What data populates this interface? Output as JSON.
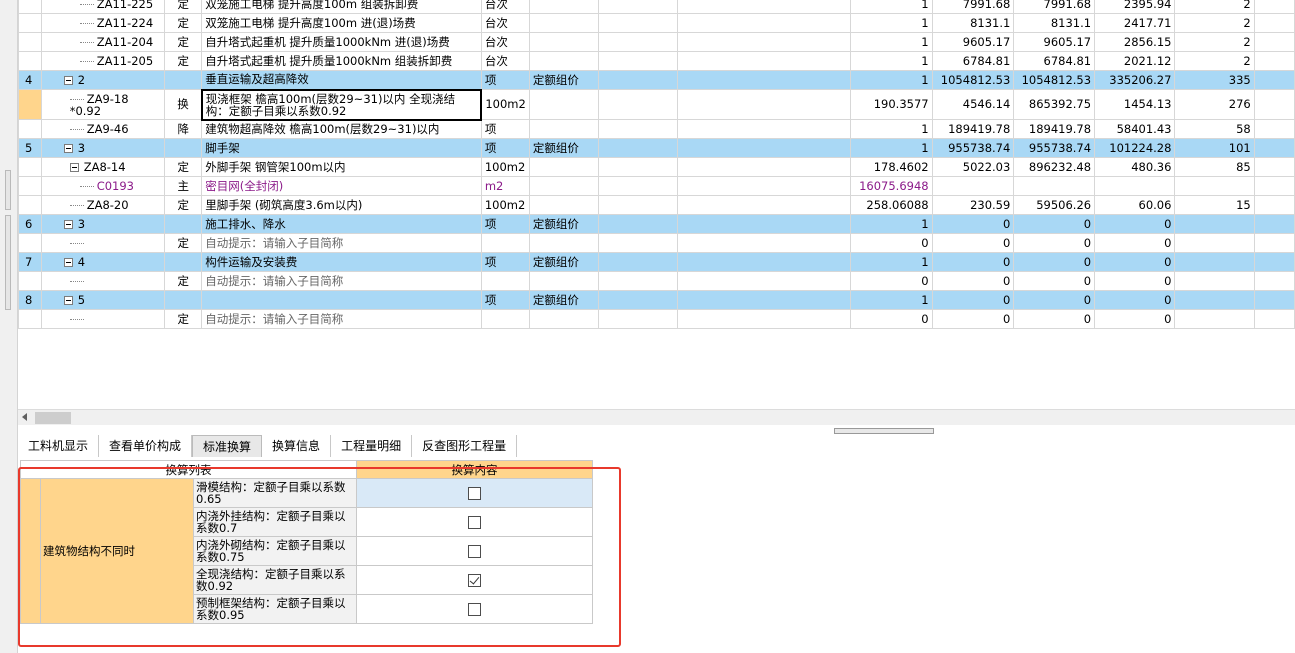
{
  "rows": [
    {
      "no": "",
      "code": "ZA11-225",
      "type": "定",
      "name": "双笼施工电梯 提升高度100m 组装拆卸费",
      "unit": "台次",
      "fee": "",
      "qty": "1",
      "price": "7991.68",
      "total": "7991.68",
      "labor": "2395.94",
      "extra": "2",
      "level": 2,
      "style": "normal"
    },
    {
      "no": "",
      "code": "ZA11-224",
      "type": "定",
      "name": "双笼施工电梯 提升高度100m 进(退)场费",
      "unit": "台次",
      "fee": "",
      "qty": "1",
      "price": "8131.1",
      "total": "8131.1",
      "labor": "2417.71",
      "extra": "2",
      "level": 2,
      "style": "normal"
    },
    {
      "no": "",
      "code": "ZA11-204",
      "type": "定",
      "name": "自升塔式起重机 提升质量1000kNm 进(退)场费",
      "unit": "台次",
      "fee": "",
      "qty": "1",
      "price": "9605.17",
      "total": "9605.17",
      "labor": "2856.15",
      "extra": "2",
      "level": 2,
      "style": "normal"
    },
    {
      "no": "",
      "code": "ZA11-205",
      "type": "定",
      "name": "自升塔式起重机 提升质量1000kNm 组装拆卸费",
      "unit": "台次",
      "fee": "",
      "qty": "1",
      "price": "6784.81",
      "total": "6784.81",
      "labor": "2021.12",
      "extra": "2",
      "level": 2,
      "style": "normal"
    },
    {
      "no": "4",
      "code": "2",
      "type": "",
      "name": "垂直运输及超高降效",
      "unit": "项",
      "fee": "定额组价",
      "qty": "1",
      "price": "1054812.53",
      "total": "1054812.53",
      "labor": "335206.27",
      "extra": "335",
      "level": 0,
      "style": "hl"
    },
    {
      "no": "",
      "code": "ZA9-18 *0.92",
      "type": "换",
      "name": "现浇框架 檐高100m(层数29~31)以内  全现浇结构：定额子目乘以系数0.92",
      "unit": "100m2",
      "fee": "",
      "qty": "190.3577",
      "price": "4546.14",
      "total": "865392.75",
      "labor": "1454.13",
      "extra": "276",
      "level": 1,
      "style": "sel"
    },
    {
      "no": "",
      "code": "ZA9-46",
      "type": "降",
      "name": "建筑物超高降效 檐高100m(层数29~31)以内",
      "unit": "项",
      "fee": "",
      "qty": "1",
      "price": "189419.78",
      "total": "189419.78",
      "labor": "58401.43",
      "extra": "58",
      "level": 1,
      "style": "normal"
    },
    {
      "no": "5",
      "code": "3",
      "type": "",
      "name": "脚手架",
      "unit": "项",
      "fee": "定额组价",
      "qty": "1",
      "price": "955738.74",
      "total": "955738.74",
      "labor": "101224.28",
      "extra": "101",
      "level": 0,
      "style": "hl"
    },
    {
      "no": "",
      "code": "ZA8-14",
      "type": "定",
      "name": "外脚手架 钢管架100m以内",
      "unit": "100m2",
      "fee": "",
      "qty": "178.4602",
      "price": "5022.03",
      "total": "896232.48",
      "labor": "480.36",
      "extra": "85",
      "level": 1,
      "style": "normal",
      "expand": true
    },
    {
      "no": "",
      "code": "C0193",
      "type": "主",
      "name": "密目网(全封闭)",
      "unit": "m2",
      "fee": "",
      "qty": "16075.6948",
      "price": "",
      "total": "",
      "labor": "",
      "extra": "",
      "level": 2,
      "style": "purple"
    },
    {
      "no": "",
      "code": "ZA8-20",
      "type": "定",
      "name": "里脚手架 (砌筑高度3.6m以内)",
      "unit": "100m2",
      "fee": "",
      "qty": "258.06088",
      "price": "230.59",
      "total": "59506.26",
      "labor": "60.06",
      "extra": "15",
      "level": 1,
      "style": "normal"
    },
    {
      "no": "6",
      "code": "3",
      "type": "",
      "name": "施工排水、降水",
      "unit": "项",
      "fee": "定额组价",
      "qty": "1",
      "price": "0",
      "total": "0",
      "labor": "0",
      "extra": "",
      "level": 0,
      "style": "hl"
    },
    {
      "no": "",
      "code": "",
      "type": "定",
      "name": "自动提示：请输入子目简称",
      "unit": "",
      "fee": "",
      "qty": "0",
      "price": "0",
      "total": "0",
      "labor": "0",
      "extra": "",
      "level": 1,
      "style": "hint"
    },
    {
      "no": "7",
      "code": "4",
      "type": "",
      "name": "构件运输及安装费",
      "unit": "项",
      "fee": "定额组价",
      "qty": "1",
      "price": "0",
      "total": "0",
      "labor": "0",
      "extra": "",
      "level": 0,
      "style": "hl"
    },
    {
      "no": "",
      "code": "",
      "type": "定",
      "name": "自动提示：请输入子目简称",
      "unit": "",
      "fee": "",
      "qty": "0",
      "price": "0",
      "total": "0",
      "labor": "0",
      "extra": "",
      "level": 1,
      "style": "hint"
    },
    {
      "no": "8",
      "code": "5",
      "type": "",
      "name": "",
      "unit": "项",
      "fee": "定额组价",
      "qty": "1",
      "price": "0",
      "total": "0",
      "labor": "0",
      "extra": "",
      "level": 0,
      "style": "hl"
    },
    {
      "no": "",
      "code": "",
      "type": "定",
      "name": "自动提示：请输入子目简称",
      "unit": "",
      "fee": "",
      "qty": "0",
      "price": "0",
      "total": "0",
      "labor": "0",
      "extra": "",
      "level": 1,
      "style": "hint"
    }
  ],
  "tabs": [
    "工料机显示",
    "查看单价构成",
    "标准换算",
    "换算信息",
    "工程量明细",
    "反查图形工程量"
  ],
  "active_tab": 2,
  "conversion": {
    "header_list": "换算列表",
    "header_content": "换算内容",
    "category": "建筑物结构不同时",
    "items": [
      {
        "label": "滑模结构：定额子目乘以系数0.65",
        "checked": false
      },
      {
        "label": "内浇外挂结构：定额子目乘以系数0.7",
        "checked": false
      },
      {
        "label": "内浇外砌结构：定额子目乘以系数0.75",
        "checked": false
      },
      {
        "label": "全现浇结构：定额子目乘以系数0.92",
        "checked": true
      },
      {
        "label": "预制框架结构：定额子目乘以系数0.95",
        "checked": false
      }
    ]
  },
  "colors": {
    "highlight": "#a9d8f5",
    "orange": "#ffd58c",
    "red_frame": "#e8392c",
    "purple": "#8b1a89"
  }
}
